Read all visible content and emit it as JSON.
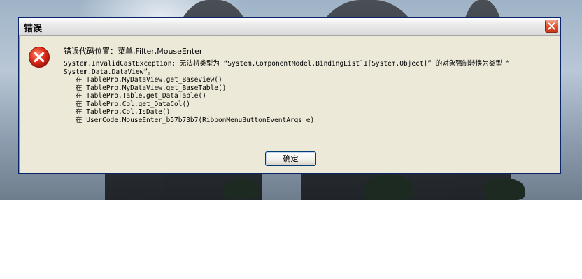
{
  "dialog": {
    "title": "错误",
    "heading": "错误代码位置：菜单,Filter,MouseEnter",
    "message_lines": [
      "System.InvalidCastException: 无法将类型为 “System.ComponentModel.BindingList`1[System.Object]” 的对象强制转换为类型 “",
      "System.Data.DataView”。"
    ],
    "stack_trace": [
      "在 TablePro.MyDataView.get_BaseView()",
      "在 TablePro.MyDataView.get_BaseTable()",
      "在 TablePro.Table.get_DataTable()",
      "在 TablePro.Col.get_DataCol()",
      "在 TablePro.Col.IsDate()",
      "在 UserCode.MouseEnter_b57b73b7(RibbonMenuButtonEventArgs e)"
    ],
    "ok_label": "确定",
    "icons": {
      "error": "error-x-icon",
      "close": "close-icon"
    }
  },
  "colors": {
    "dialog_bg": "#ece9d8",
    "error_red": "#d8261c",
    "close_red": "#e0522b"
  }
}
